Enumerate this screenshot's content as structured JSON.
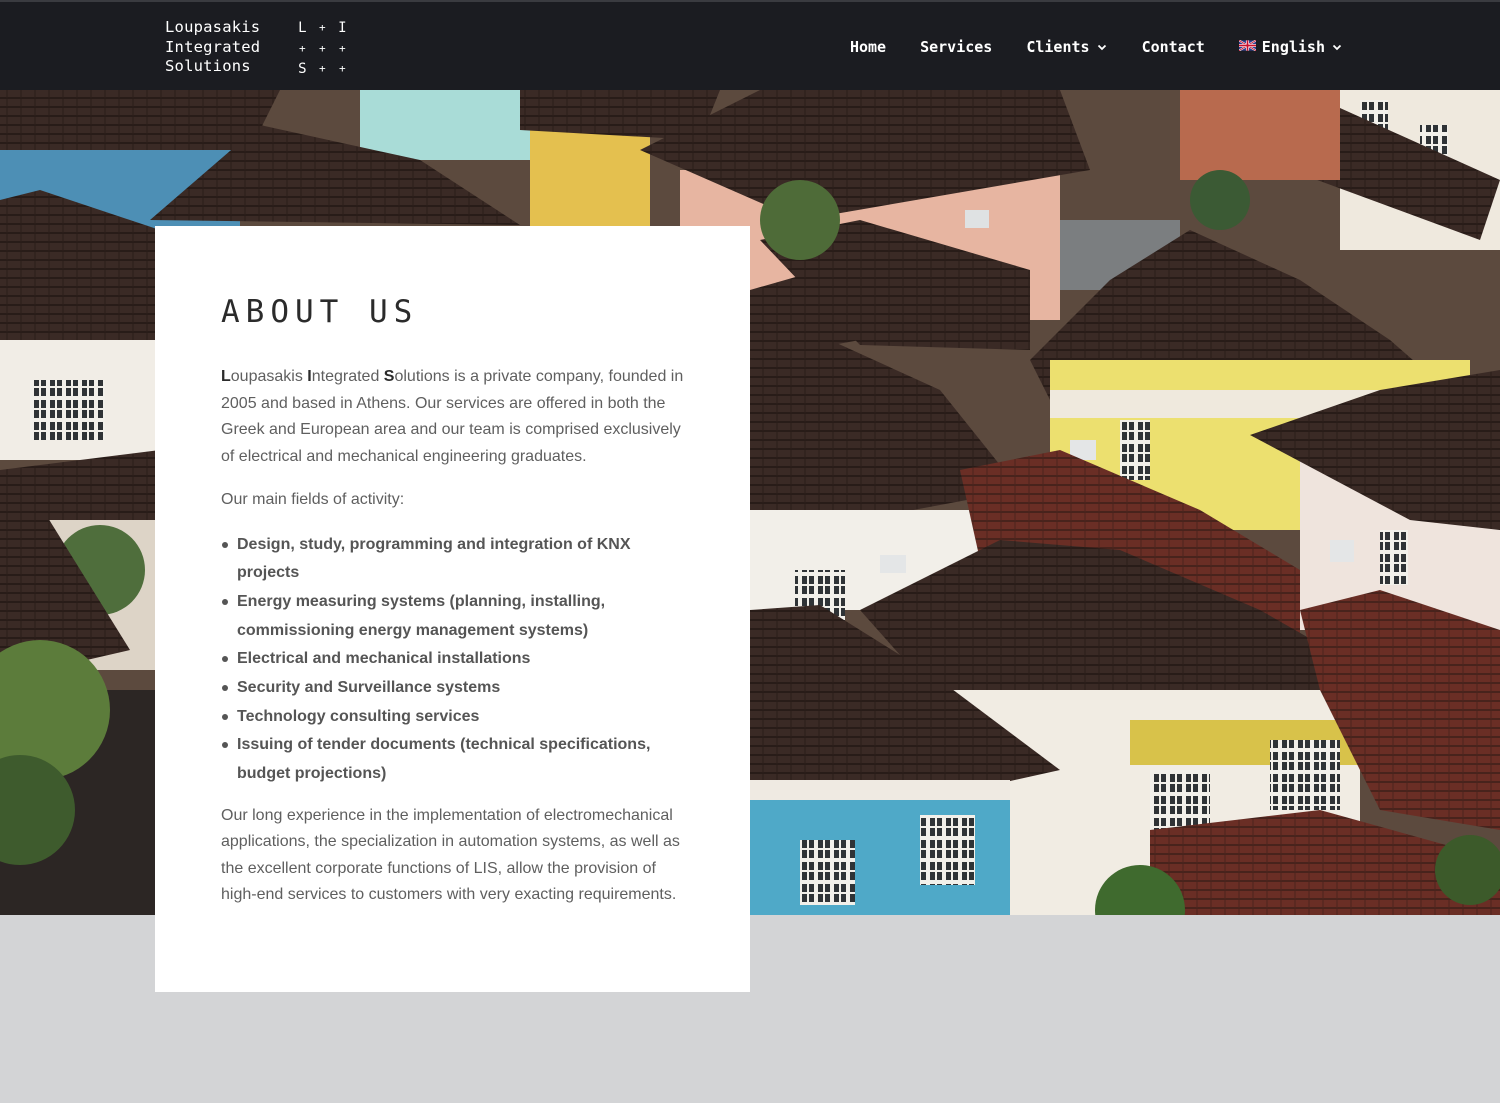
{
  "header": {
    "logo": {
      "words": [
        "Loupasakis",
        "Integrated",
        "Solutions"
      ],
      "mark": [
        "L",
        "+",
        "I",
        "+",
        "+",
        "+",
        "S",
        "+",
        "+"
      ]
    },
    "nav": {
      "home": "Home",
      "services": "Services",
      "clients": "Clients",
      "contact": "Contact",
      "language": "English"
    },
    "icons": {
      "clients_dropdown": "chevron-down-icon",
      "language_flag": "flag-uk-icon",
      "language_dropdown": "chevron-down-icon"
    },
    "colors": {
      "header_background": "#1b1c21",
      "page_background": "#d3d4d6"
    }
  },
  "about": {
    "title": "ABOUT US",
    "intro": {
      "l1": "L",
      "r1": "oupasakis ",
      "l2": "I",
      "r2": "ntegrated ",
      "l3": "S",
      "r3": "olutions is a private company, founded in 2005 and based in Athens. Our services are offered in both the Greek and European area and our team is comprised exclusively of electrical and mechanical engineering graduates."
    },
    "fields_heading": "Our main fields of activity:",
    "fields": [
      "Design, study, programming and integration of KNX projects",
      "Energy measuring systems (planning, installing, commissioning energy management systems)",
      "Electrical and mechanical installations",
      "Security and Surveillance systems",
      "Technology consulting services",
      "Issuing of tender documents (technical specifications, budget projections)"
    ],
    "closing": "Our long experience in the implementation of electromechanical applications, the specialization in automation systems, as well as the excellent corporate functions of LIS, allow the provision of high-end services to customers with very exacting requirements."
  }
}
